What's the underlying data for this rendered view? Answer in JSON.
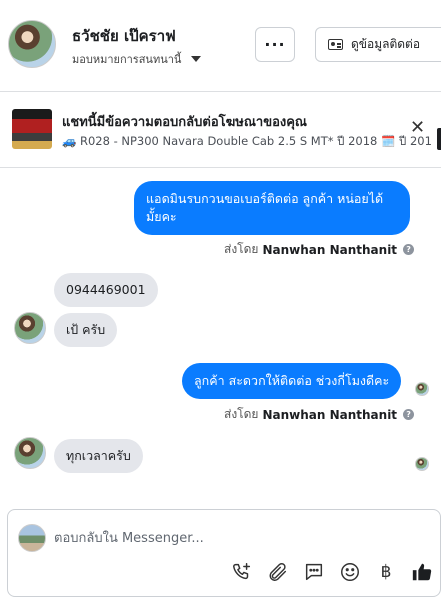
{
  "header": {
    "contact_name": "ธวัชชัย เป๊คราฟ",
    "assign_label": "มอบหมายการสนทนานี้",
    "more_label": "···",
    "contact_info_label": "ดูข้อมูลติดต่อ"
  },
  "ad": {
    "title": "แชทนี้มีข้อความตอบกลับต่อโฆษณาของคุณ",
    "subtitle": "🚙 R028 - NP300 Navara Double Cab 2.5 S MT* ปี 2018 🗓️ ปี 201...",
    "close": "✕"
  },
  "thread": {
    "messages": [
      {
        "direction": "out",
        "text": "แอดมินรบกวนขอเบอร์ติดต่อ ลูกค้า  หน่อยได้มั้ยคะ"
      },
      {
        "direction": "in",
        "text": "0944469001"
      },
      {
        "direction": "in",
        "text": "เป้ ครับ"
      },
      {
        "direction": "out",
        "text": "ลูกค้า สะดวกให้ติดต่อ ช่วงกี่โมงดีคะ"
      },
      {
        "direction": "in",
        "text": "ทุกเวลาครับ"
      }
    ],
    "sent_by_prefix": "ส่งโดย",
    "sent_by_name": "Nanwhan Nanthanit",
    "help_glyph": "?"
  },
  "composer": {
    "placeholder": "ตอบกลับใน Messenger...",
    "tools": [
      "phone-plus-icon",
      "attachment-icon",
      "saved-reply-icon",
      "emoji-icon",
      "baht-icon",
      "thumbs-up-icon"
    ],
    "baht_glyph": "฿"
  },
  "colors": {
    "outgoing_bubble": "#0a7cff",
    "incoming_bubble": "#e4e6eb",
    "like_icon": "#1c1e21"
  }
}
